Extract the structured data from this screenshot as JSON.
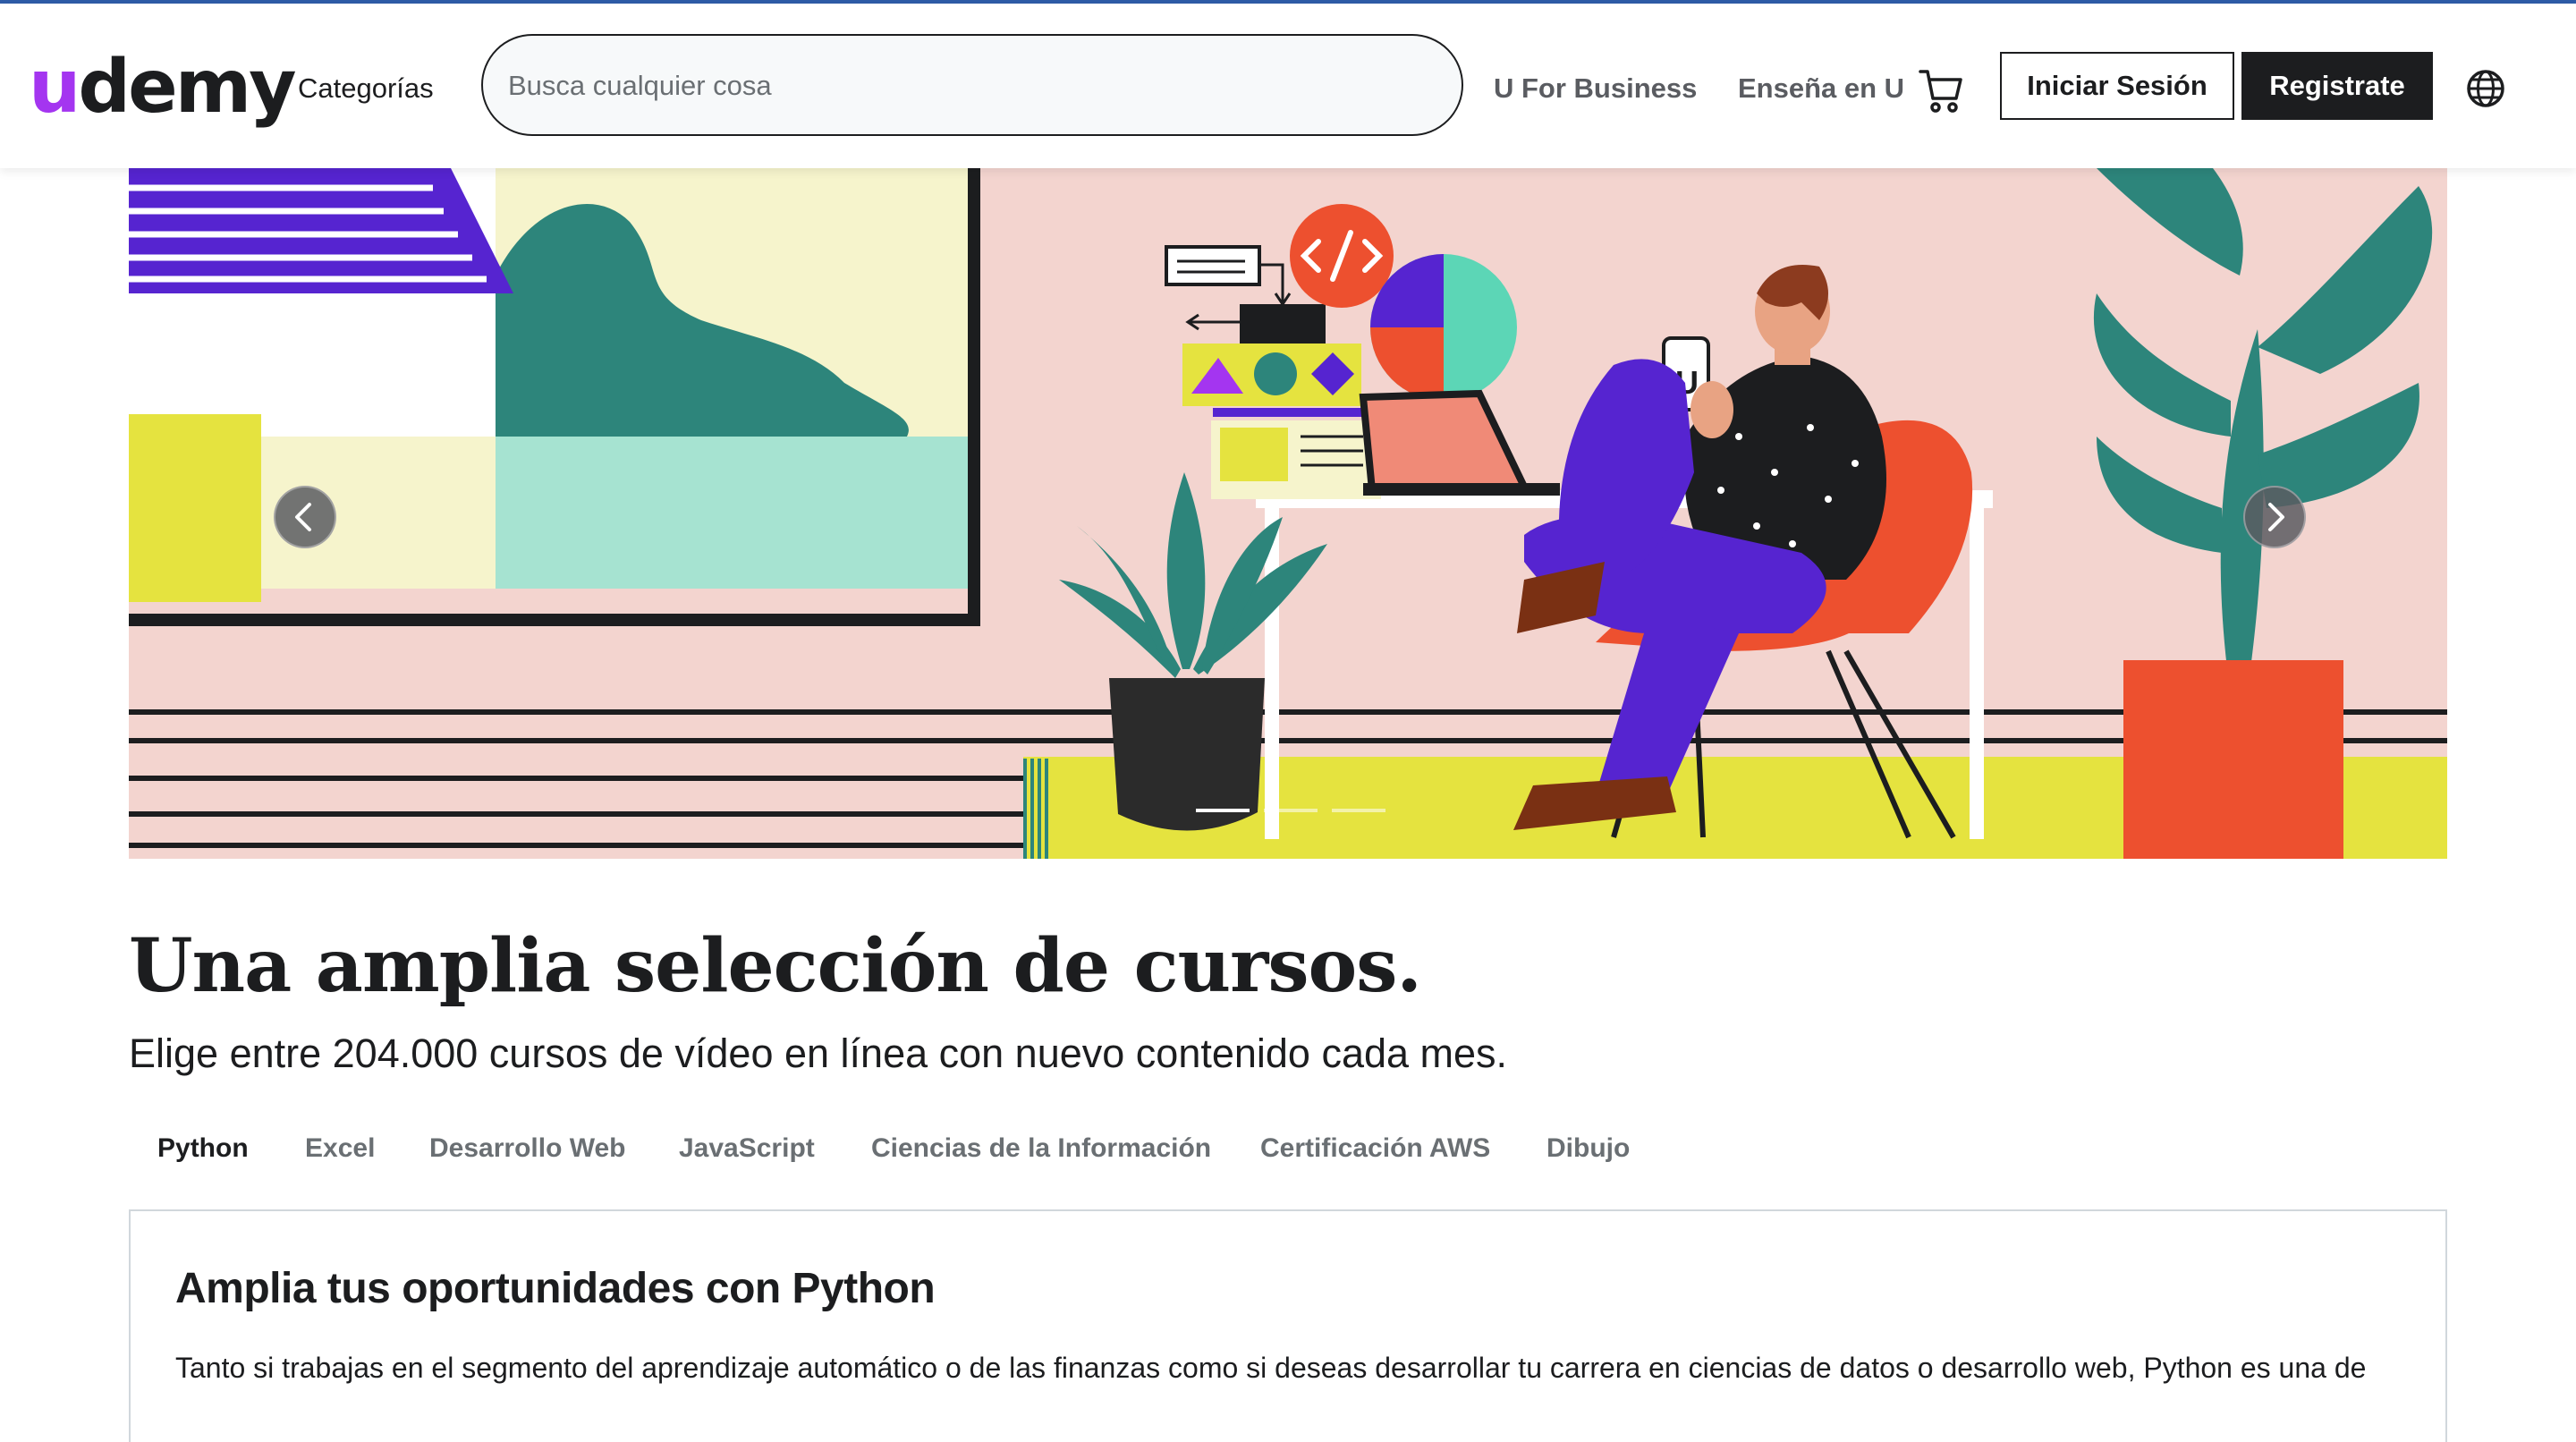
{
  "header": {
    "logo_text": "udemy",
    "categories_label": "Categorías",
    "search_placeholder": "Busca cualquier cosa",
    "business_label": "U For Business",
    "teach_label": "Enseña en U",
    "login_label": "Iniciar Sesión",
    "signup_label": "Registrate",
    "icons": [
      "search-input",
      "cart-icon",
      "globe-icon"
    ]
  },
  "banner": {
    "slides_count": 3,
    "active_slide": 1,
    "illustration": "person-on-phone-at-desk",
    "colors": {
      "accent_purple": "#a435f0",
      "pink_wall": "#f3d4cf",
      "teal": "#2d857b",
      "mint": "#a6e3d1",
      "yellow": "#e5e33f",
      "orange": "#ed502f",
      "violet": "#5624d0"
    }
  },
  "main": {
    "headline": "Una amplia selección de cursos.",
    "subheadline": "Elige entre 204.000 cursos de vídeo en línea con nuevo contenido cada mes.",
    "tabs": [
      {
        "label": "Python",
        "active": true
      },
      {
        "label": "Excel",
        "active": false
      },
      {
        "label": "Desarrollo Web",
        "active": false
      },
      {
        "label": "JavaScript",
        "active": false
      },
      {
        "label": "Ciencias de la Información",
        "active": false
      },
      {
        "label": "Certificación AWS",
        "active": false
      },
      {
        "label": "Dibujo",
        "active": false
      }
    ],
    "panel": {
      "title": "Amplia tus oportunidades con Python",
      "text": "Tanto si trabajas en el segmento del aprendizaje automático o de las finanzas como si deseas desarrollar tu carrera en ciencias de datos o desarrollo web, Python es una de"
    }
  }
}
